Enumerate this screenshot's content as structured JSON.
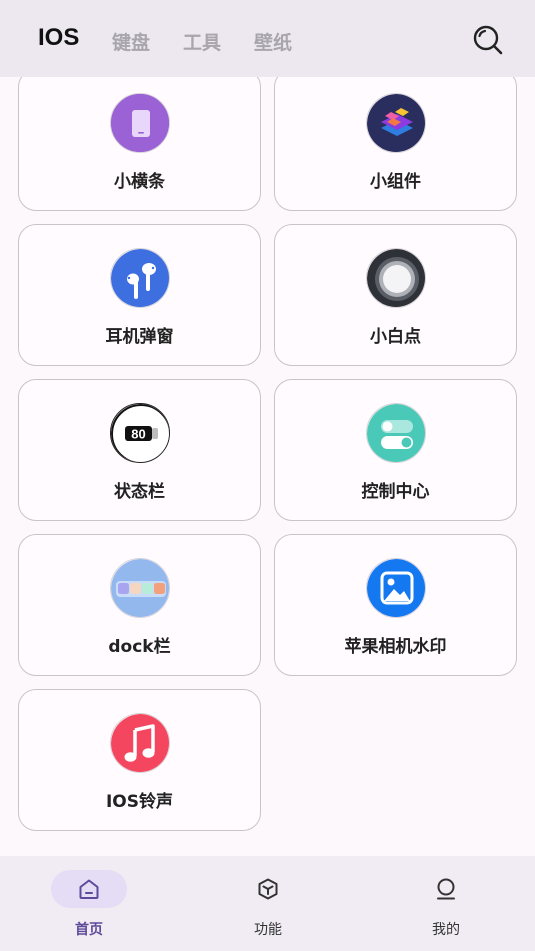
{
  "header": {
    "tabs": [
      {
        "label": "IOS"
      },
      {
        "label": "键盘"
      },
      {
        "label": "工具"
      },
      {
        "label": "壁纸"
      }
    ]
  },
  "cards": [
    {
      "label": "小横条",
      "icon": "phone-icon"
    },
    {
      "label": "小组件",
      "icon": "widgets-icon"
    },
    {
      "label": "耳机弹窗",
      "icon": "airpods-icon"
    },
    {
      "label": "小白点",
      "icon": "assistive-touch-icon"
    },
    {
      "label": "状态栏",
      "icon": "battery-icon",
      "battery_value": "80"
    },
    {
      "label": "控制中心",
      "icon": "toggle-icon"
    },
    {
      "label": "dock栏",
      "icon": "dock-icon"
    },
    {
      "label": "苹果相机水印",
      "icon": "photo-icon"
    },
    {
      "label": "IOS铃声",
      "icon": "music-note-icon"
    }
  ],
  "bottom_nav": [
    {
      "label": "首页",
      "icon": "home-icon",
      "active": true
    },
    {
      "label": "功能",
      "icon": "cube-icon",
      "active": false
    },
    {
      "label": "我的",
      "icon": "person-icon",
      "active": false
    }
  ],
  "colors": {
    "accent": "#5d4b9a",
    "header_bg": "#ede8ef",
    "nav_bg": "#f1ecf3"
  }
}
